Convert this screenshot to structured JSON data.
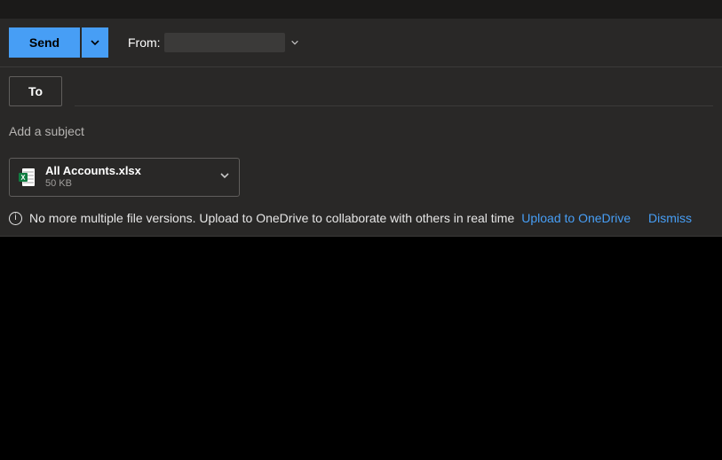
{
  "toolbar": {
    "send_label": "Send",
    "from_label": "From:"
  },
  "recipients": {
    "to_label": "To"
  },
  "subject": {
    "placeholder": "Add a subject"
  },
  "attachment": {
    "filename": "All Accounts.xlsx",
    "size": "50 KB"
  },
  "info_banner": {
    "text": "No more multiple file versions. Upload to OneDrive to collaborate with others in real time",
    "upload_link": "Upload to OneDrive",
    "dismiss_link": "Dismiss"
  }
}
